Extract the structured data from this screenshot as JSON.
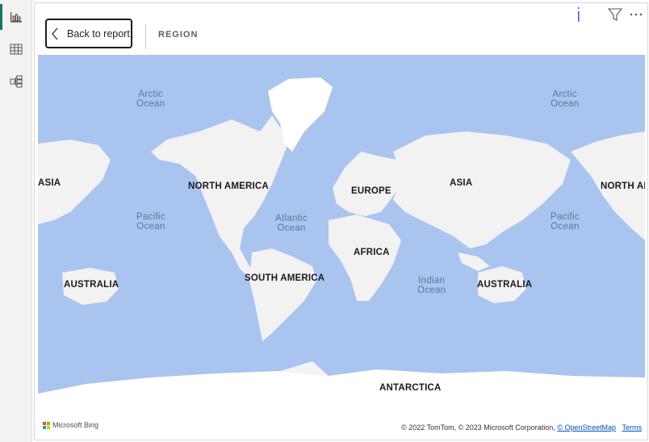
{
  "nav": {
    "items": [
      {
        "name": "report-view",
        "icon": "bar-chart-icon",
        "active": true
      },
      {
        "name": "data-view",
        "icon": "table-icon",
        "active": false
      },
      {
        "name": "model-view",
        "icon": "model-icon",
        "active": false
      }
    ]
  },
  "header": {
    "back_label": "Back to report",
    "breadcrumb": "REGION"
  },
  "toolbar": {
    "icons": [
      "info-icon",
      "filter-icon",
      "more-options-icon"
    ]
  },
  "map": {
    "regions": [
      "ASIA",
      "NORTH AMERICA",
      "EUROPE",
      "ASIA",
      "NORTH AM",
      "AFRICA",
      "AUSTRALIA",
      "SOUTH AMERICA",
      "AUSTRALIA",
      "ANTARCTICA"
    ],
    "oceans": [
      "Arctic\nOcean",
      "Arctic\nOcean",
      "Pacific\nOcean",
      "Atlantic\nOcean",
      "Pacific\nOcean",
      "Indian\nOcean"
    ],
    "bing_label": "Microsoft Bing",
    "attribution": {
      "text": "© 2022 TomTom, © 2023 Microsoft Corporation, ",
      "osm_link": "© OpenStreetMap",
      "terms_link": "Terms"
    },
    "colors": {
      "water": "#a9c4ef",
      "land": "#f2f2f2",
      "ice": "#ffffff"
    }
  }
}
